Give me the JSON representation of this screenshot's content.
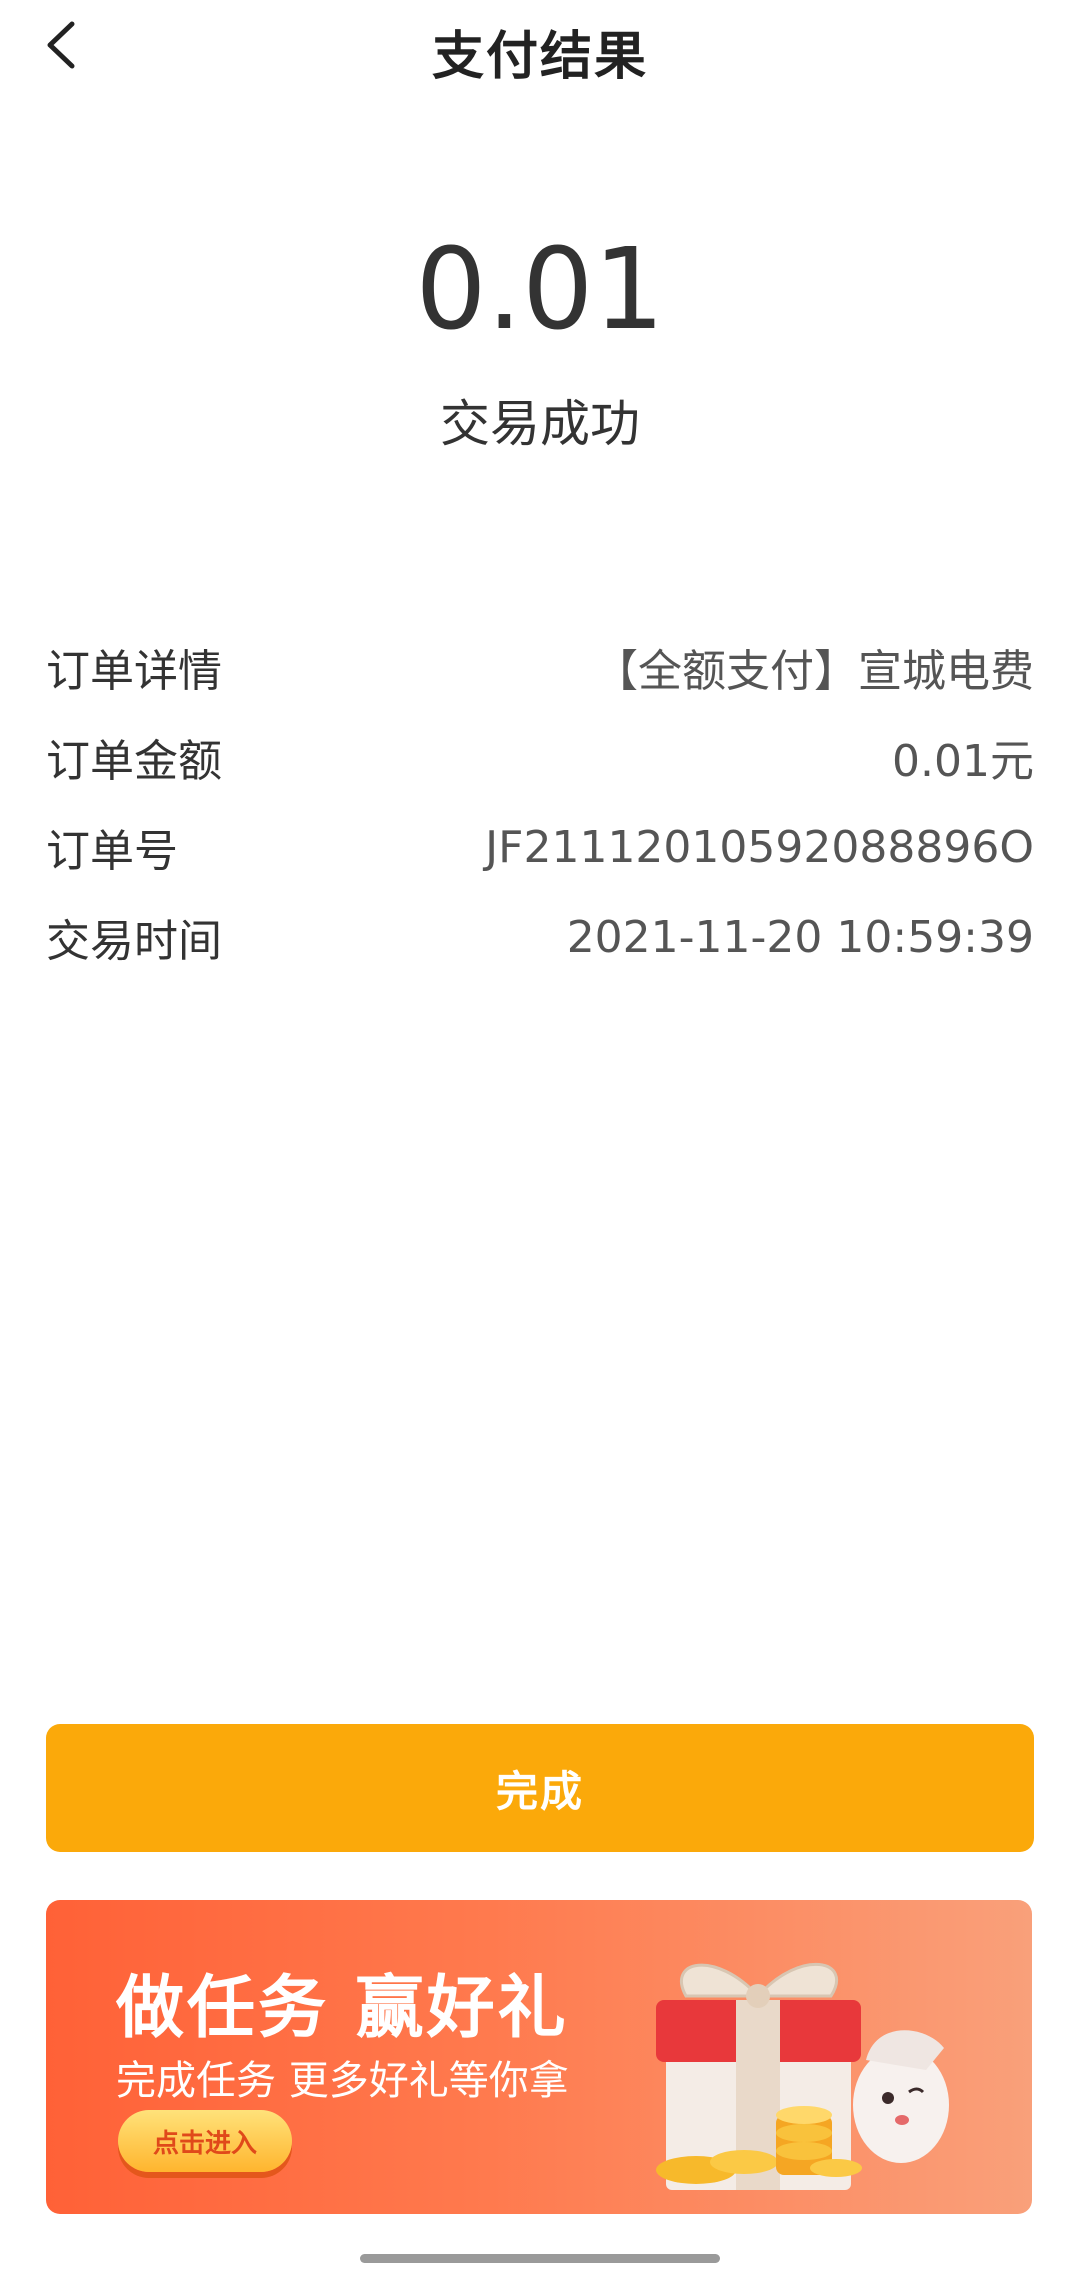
{
  "header": {
    "title": "支付结果"
  },
  "payment": {
    "amount": "0.01",
    "status": "交易成功"
  },
  "details": [
    {
      "label": "订单详情",
      "value": "【全额支付】宣城电费"
    },
    {
      "label": "订单金额",
      "value": "0.01元"
    },
    {
      "label": "订单号",
      "value": "JF21112010592088896O"
    },
    {
      "label": "交易时间",
      "value": "2021-11-20 10:59:39"
    }
  ],
  "actions": {
    "done_label": "完成"
  },
  "banner": {
    "title": "做任务 赢好礼",
    "subtitle": "完成任务 更多好礼等你拿",
    "cta_label": "点击进入"
  },
  "colors": {
    "primary_button": "#FBA90A",
    "banner_start": "#FF6137",
    "banner_end": "#F9A07A"
  }
}
